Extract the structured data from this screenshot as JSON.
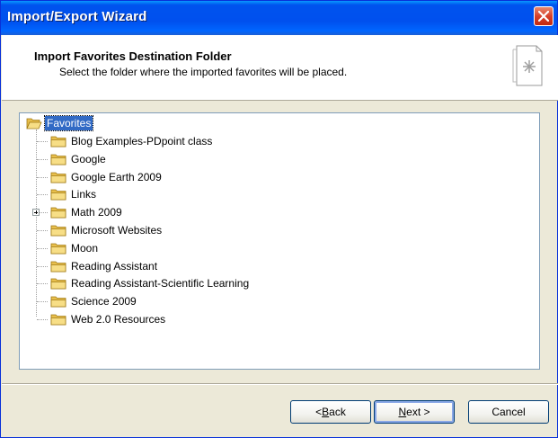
{
  "window": {
    "title": "Import/Export Wizard"
  },
  "header": {
    "title": "Import Favorites Destination Folder",
    "subtitle": "Select the folder where the imported favorites will be placed."
  },
  "tree": {
    "root": {
      "label": "Favorites",
      "selected": true
    },
    "items": [
      {
        "label": "Blog Examples-PDpoint class",
        "expandable": false
      },
      {
        "label": "Google",
        "expandable": false
      },
      {
        "label": "Google Earth 2009",
        "expandable": false
      },
      {
        "label": "Links",
        "expandable": false
      },
      {
        "label": "Math 2009",
        "expandable": true
      },
      {
        "label": "Microsoft Websites",
        "expandable": false
      },
      {
        "label": "Moon",
        "expandable": false
      },
      {
        "label": "Reading Assistant",
        "expandable": false
      },
      {
        "label": "Reading Assistant-Scientific Learning",
        "expandable": false
      },
      {
        "label": "Science 2009",
        "expandable": false
      },
      {
        "label": "Web 2.0 Resources",
        "expandable": false
      }
    ]
  },
  "buttons": {
    "back_prefix": "< ",
    "back_key": "B",
    "back_rest": "ack",
    "next_key": "N",
    "next_rest": "ext >",
    "cancel": "Cancel"
  },
  "colors": {
    "titlebar": "#0054e3",
    "selection": "#316ac5",
    "folder": "#f2d27a",
    "dialog": "#ece9d8"
  },
  "icons": {
    "close": "close-icon",
    "folder": "folder-icon",
    "wizard": "wizard-page-icon",
    "expand": "plus-expander-icon"
  }
}
